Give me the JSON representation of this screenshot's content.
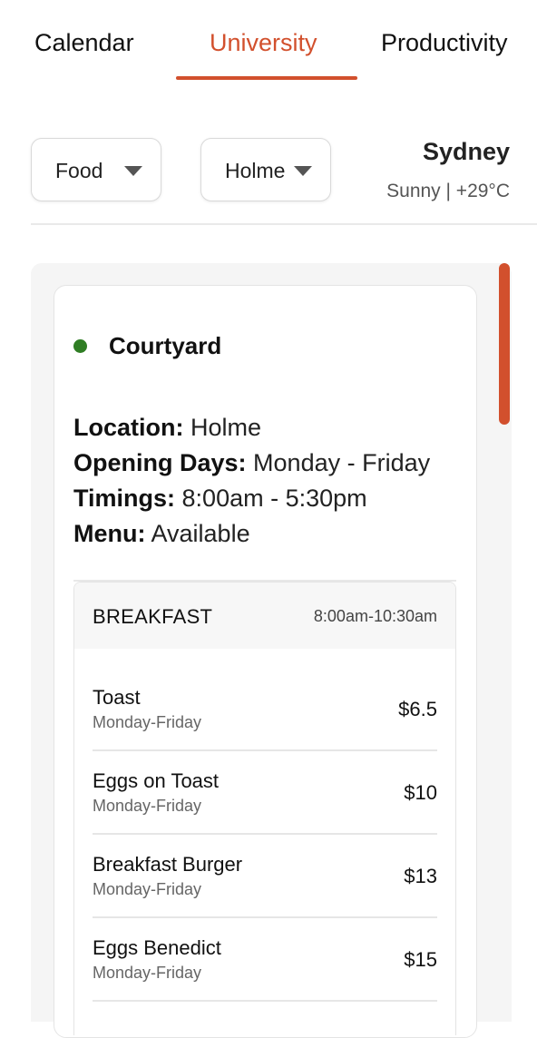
{
  "tabs": [
    {
      "label": "Calendar",
      "active": false
    },
    {
      "label": "University",
      "active": true
    },
    {
      "label": "Productivity",
      "active": false
    }
  ],
  "filters": {
    "category": "Food",
    "campus": "Holme"
  },
  "weather": {
    "city": "Sydney",
    "summary": "Sunny | +29°C"
  },
  "colors": {
    "accent": "#d2502d",
    "status_open": "#2f7d24"
  },
  "venue": {
    "name": "Courtyard",
    "location_label": "Location:",
    "location": "Holme",
    "days_label": "Opening Days:",
    "days": "Monday - Friday",
    "timings_label": "Timings:",
    "timings": "8:00am - 5:30pm",
    "menu_label": "Menu:",
    "menu": "Available"
  },
  "menu_section": {
    "title": "BREAKFAST",
    "hours": "8:00am-10:30am",
    "items": [
      {
        "name": "Toast",
        "days": "Monday-Friday",
        "price": "$6.5"
      },
      {
        "name": "Eggs on Toast",
        "days": "Monday-Friday",
        "price": "$10"
      },
      {
        "name": "Breakfast Burger",
        "days": "Monday-Friday",
        "price": "$13"
      },
      {
        "name": "Eggs Benedict",
        "days": "Monday-Friday",
        "price": "$15"
      }
    ]
  }
}
